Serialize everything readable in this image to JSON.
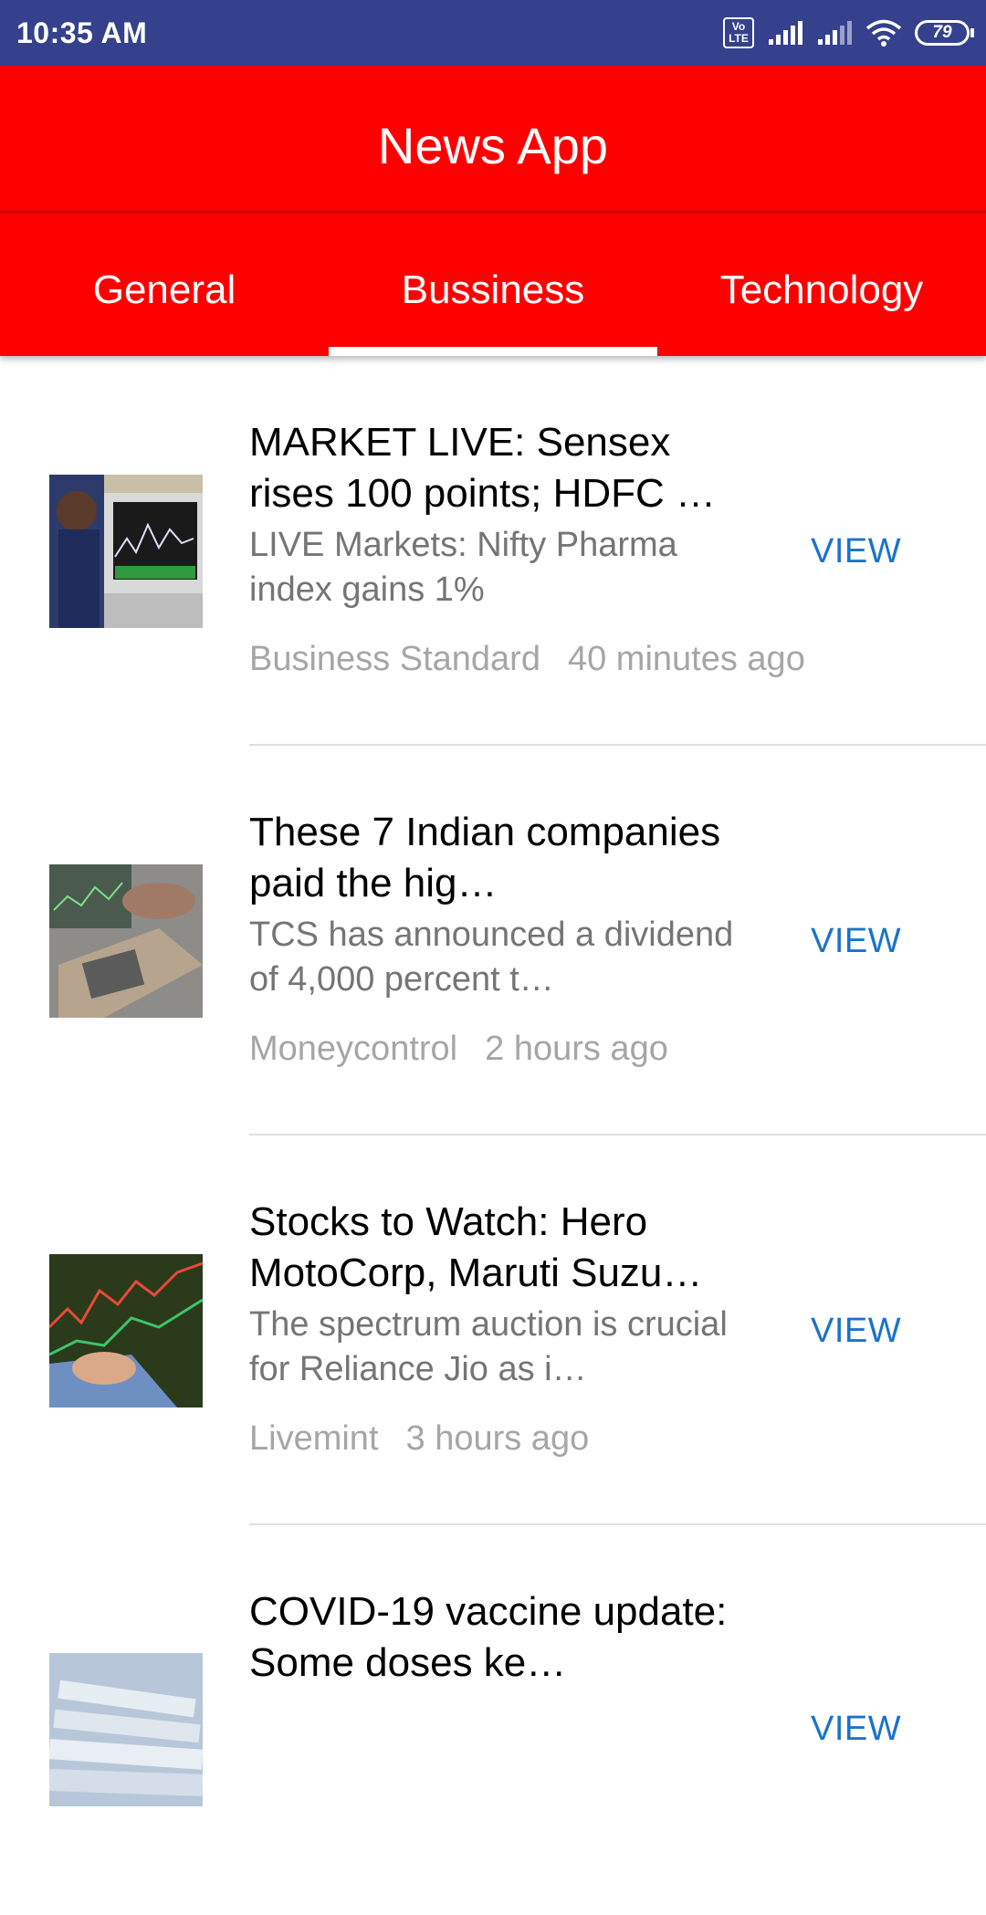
{
  "status_bar": {
    "time": "10:35 AM",
    "volte": "Vo LTE",
    "battery": "79"
  },
  "app_bar": {
    "title": "News App"
  },
  "tabs": [
    {
      "label": "General",
      "active": false
    },
    {
      "label": "Bussiness",
      "active": true
    },
    {
      "label": "Technology",
      "active": false
    }
  ],
  "articles": [
    {
      "headline": "MARKET LIVE: Sensex rises 100 points; HDFC …",
      "description": "LIVE Markets: Nifty Pharma index gains 1%",
      "source": "Business Standard",
      "time": "40 minutes ago",
      "action": "VIEW"
    },
    {
      "headline": "These 7 Indian companies paid the hig…",
      "description": "TCS has announced a dividend of 4,000 percent t…",
      "source": "Moneycontrol",
      "time": "2 hours ago",
      "action": "VIEW"
    },
    {
      "headline": "Stocks to Watch: Hero MotoCorp, Maruti Suzu…",
      "description": "The spectrum auction is crucial for Reliance Jio as i…",
      "source": "Livemint",
      "time": "3 hours ago",
      "action": "VIEW"
    },
    {
      "headline": "COVID-19 vaccine update: Some doses ke…",
      "description": "",
      "source": "",
      "time": "",
      "action": "VIEW"
    }
  ],
  "colors": {
    "status_bar": "#35418c",
    "app_bar": "#ff0000",
    "accent": "#1a73c9",
    "headline": "#000000",
    "description": "#757575",
    "meta": "#a6a6a6"
  }
}
